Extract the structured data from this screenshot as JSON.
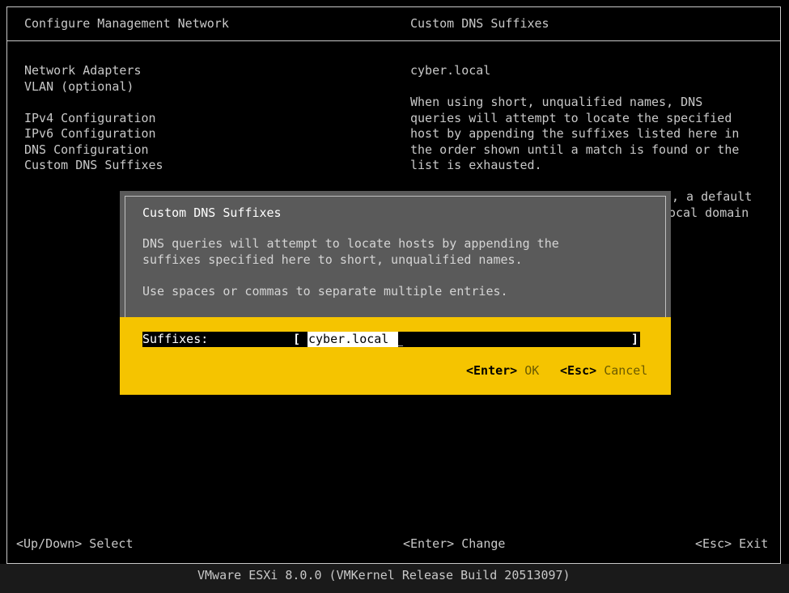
{
  "left_panel": {
    "title": "Configure Management Network",
    "menu": [
      "Network Adapters",
      "VLAN (optional)",
      "IPv4 Configuration",
      "IPv6 Configuration",
      "DNS Configuration",
      "Custom DNS Suffixes"
    ]
  },
  "right_panel": {
    "title": "Custom DNS Suffixes",
    "value": "cyber.local",
    "description": [
      "When using short, unqualified names, DNS",
      "queries will attempt to locate the specified",
      "host by appending the suffixes listed here in",
      "the order shown until a match is found or the",
      "list is exhausted."
    ],
    "partial_lines": [
      ", a default",
      "ocal domain"
    ]
  },
  "dialog": {
    "title": "Custom DNS Suffixes",
    "description": [
      "DNS queries will attempt to locate hosts by appending the",
      "suffixes specified here to short, unqualified names."
    ],
    "hint": "Use spaces or commas to separate multiple entries.",
    "field_label": "Suffixes:",
    "field_open": "[",
    "field_value": "cyber.local",
    "field_cursor": "_",
    "field_close": "]",
    "enter_key": "<Enter>",
    "enter_action": "OK",
    "esc_key": "<Esc>",
    "esc_action": "Cancel"
  },
  "status_bar": {
    "left": "<Up/Down> Select",
    "center": "<Enter> Change",
    "right": "<Esc> Exit"
  },
  "footer": "VMware ESXi 8.0.0 (VMKernel Release Build 20513097)",
  "colors": {
    "background": "#000000",
    "text": "#c8c8c8",
    "dialog_bg": "#5a5a5a",
    "accent_yellow": "#f5c400"
  }
}
